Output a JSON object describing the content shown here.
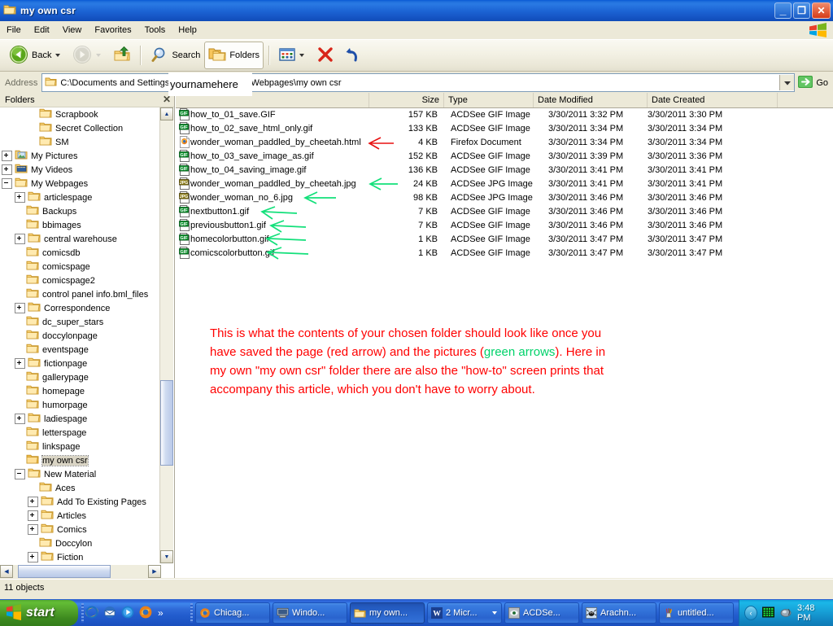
{
  "window": {
    "title": "my own csr",
    "icon": "folder-icon",
    "minimize_label": "_",
    "maximize_label": "❐",
    "close_label": "✕"
  },
  "menubar": {
    "items": [
      {
        "label": "File"
      },
      {
        "label": "Edit"
      },
      {
        "label": "View"
      },
      {
        "label": "Favorites"
      },
      {
        "label": "Tools"
      },
      {
        "label": "Help"
      }
    ],
    "brand_icon": "windows-flag-icon"
  },
  "toolbar": {
    "back_label": "Back",
    "back_icon": "back-arrow-icon",
    "forward_icon": "forward-arrow-icon",
    "up_icon": "up-folder-icon",
    "search_label": "Search",
    "search_icon": "magnifier-icon",
    "folders_label": "Folders",
    "folders_icon": "folders-icon",
    "views_icon": "views-icon",
    "delete_icon": "delete-x-icon",
    "undo_icon": "undo-arrow-icon"
  },
  "address": {
    "label": "Address",
    "icon": "folder-icon",
    "path_before": "C:\\Documents and Settings\\",
    "path_after": "\\My Documents\\My Webpages\\my own csr",
    "overlay_text": "yournamehere",
    "go_label": "Go",
    "go_icon": "go-arrow-icon",
    "dropdown_icon": "chevron-down-icon"
  },
  "folders_pane": {
    "header": "Folders",
    "close_icon": "close-icon",
    "tree": [
      {
        "label": "Scrapbook",
        "indent": 3,
        "expander": "none",
        "icon": "folder-icon",
        "selected": false
      },
      {
        "label": "Secret Collection",
        "indent": 3,
        "expander": "none",
        "icon": "folder-icon",
        "selected": false
      },
      {
        "label": "SM",
        "indent": 3,
        "expander": "none",
        "icon": "folder-icon",
        "selected": false
      },
      {
        "label": "My Pictures",
        "indent": 1,
        "expander": "plus",
        "icon": "pictures-icon",
        "selected": false
      },
      {
        "label": "My Videos",
        "indent": 1,
        "expander": "plus",
        "icon": "videos-icon",
        "selected": false
      },
      {
        "label": "My Webpages",
        "indent": 1,
        "expander": "minus",
        "icon": "folder-icon",
        "selected": false
      },
      {
        "label": "articlespage",
        "indent": 2,
        "expander": "plus",
        "icon": "folder-icon",
        "selected": false
      },
      {
        "label": "Backups",
        "indent": 2,
        "expander": "none",
        "icon": "folder-icon",
        "selected": false
      },
      {
        "label": "bbimages",
        "indent": 2,
        "expander": "none",
        "icon": "folder-icon",
        "selected": false
      },
      {
        "label": "central warehouse",
        "indent": 2,
        "expander": "plus",
        "icon": "folder-icon",
        "selected": false
      },
      {
        "label": "comicsdb",
        "indent": 2,
        "expander": "none",
        "icon": "folder-icon",
        "selected": false
      },
      {
        "label": "comicspage",
        "indent": 2,
        "expander": "none",
        "icon": "folder-icon",
        "selected": false
      },
      {
        "label": "comicspage2",
        "indent": 2,
        "expander": "none",
        "icon": "folder-icon",
        "selected": false
      },
      {
        "label": "control panel info.bml_files",
        "indent": 2,
        "expander": "none",
        "icon": "folder-icon",
        "selected": false
      },
      {
        "label": "Correspondence",
        "indent": 2,
        "expander": "plus",
        "icon": "folder-icon",
        "selected": false
      },
      {
        "label": "dc_super_stars",
        "indent": 2,
        "expander": "none",
        "icon": "folder-icon",
        "selected": false
      },
      {
        "label": "doccylonpage",
        "indent": 2,
        "expander": "none",
        "icon": "folder-icon",
        "selected": false
      },
      {
        "label": "eventspage",
        "indent": 2,
        "expander": "none",
        "icon": "folder-icon",
        "selected": false
      },
      {
        "label": "fictionpage",
        "indent": 2,
        "expander": "plus",
        "icon": "folder-icon",
        "selected": false
      },
      {
        "label": "gallerypage",
        "indent": 2,
        "expander": "none",
        "icon": "folder-icon",
        "selected": false
      },
      {
        "label": "homepage",
        "indent": 2,
        "expander": "none",
        "icon": "folder-icon",
        "selected": false
      },
      {
        "label": "humorpage",
        "indent": 2,
        "expander": "none",
        "icon": "folder-icon",
        "selected": false
      },
      {
        "label": "ladiespage",
        "indent": 2,
        "expander": "plus",
        "icon": "folder-icon",
        "selected": false
      },
      {
        "label": "letterspage",
        "indent": 2,
        "expander": "none",
        "icon": "folder-icon",
        "selected": false
      },
      {
        "label": "linkspage",
        "indent": 2,
        "expander": "none",
        "icon": "folder-icon",
        "selected": false
      },
      {
        "label": "my own csr",
        "indent": 2,
        "expander": "none",
        "icon": "folder-open-icon",
        "selected": true
      },
      {
        "label": "New Material",
        "indent": 2,
        "expander": "minus",
        "icon": "folder-icon",
        "selected": false
      },
      {
        "label": "Aces",
        "indent": 3,
        "expander": "none",
        "icon": "folder-icon",
        "selected": false
      },
      {
        "label": "Add To Existing Pages",
        "indent": 3,
        "expander": "plus",
        "icon": "folder-icon",
        "selected": false
      },
      {
        "label": "Articles",
        "indent": 3,
        "expander": "plus",
        "icon": "folder-icon",
        "selected": false
      },
      {
        "label": "Comics",
        "indent": 3,
        "expander": "plus",
        "icon": "folder-icon",
        "selected": false
      },
      {
        "label": "Doccylon",
        "indent": 3,
        "expander": "none",
        "icon": "folder-icon",
        "selected": false
      },
      {
        "label": "Fiction",
        "indent": 3,
        "expander": "plus",
        "icon": "folder-icon",
        "selected": false
      }
    ],
    "scroll_up_icon": "scroll-up-icon",
    "scroll_down_icon": "scroll-down-icon",
    "scroll_left_icon": "scroll-left-icon",
    "scroll_right_icon": "scroll-right-icon"
  },
  "file_list": {
    "columns": [
      {
        "label": "Name",
        "align": "left"
      },
      {
        "label": "Size",
        "align": "right"
      },
      {
        "label": "Type",
        "align": "left"
      },
      {
        "label": "Date Modified",
        "align": "left"
      },
      {
        "label": "Date Created",
        "align": "left"
      }
    ],
    "rows": [
      {
        "name": "how_to_01_save.GIF",
        "icon": "gif-file-icon",
        "size": "157 KB",
        "type": "ACDSee GIF Image",
        "modified": "3/30/2011 3:32 PM",
        "created": "3/30/2011 3:30 PM",
        "arrow": "none"
      },
      {
        "name": "how_to_02_save_html_only.gif",
        "icon": "gif-file-icon",
        "size": "133 KB",
        "type": "ACDSee GIF Image",
        "modified": "3/30/2011 3:34 PM",
        "created": "3/30/2011 3:34 PM",
        "arrow": "none"
      },
      {
        "name": "wonder_woman_paddled_by_cheetah.html",
        "icon": "firefox-file-icon",
        "size": "4 KB",
        "type": "Firefox Document",
        "modified": "3/30/2011 3:34 PM",
        "created": "3/30/2011 3:34 PM",
        "arrow": "red"
      },
      {
        "name": "how_to_03_save_image_as.gif",
        "icon": "gif-file-icon",
        "size": "152 KB",
        "type": "ACDSee GIF Image",
        "modified": "3/30/2011 3:39 PM",
        "created": "3/30/2011 3:36 PM",
        "arrow": "none"
      },
      {
        "name": "how_to_04_saving_image.gif",
        "icon": "gif-file-icon",
        "size": "136 KB",
        "type": "ACDSee GIF Image",
        "modified": "3/30/2011 3:41 PM",
        "created": "3/30/2011 3:41 PM",
        "arrow": "none"
      },
      {
        "name": "wonder_woman_paddled_by_cheetah.jpg",
        "icon": "jpg-file-icon",
        "size": "24 KB",
        "type": "ACDSee JPG Image",
        "modified": "3/30/2011 3:41 PM",
        "created": "3/30/2011 3:41 PM",
        "arrow": "green"
      },
      {
        "name": "wonder_woman_no_6.jpg",
        "icon": "jpg-file-icon",
        "size": "98 KB",
        "type": "ACDSee JPG Image",
        "modified": "3/30/2011 3:46 PM",
        "created": "3/30/2011 3:46 PM",
        "arrow": "green"
      },
      {
        "name": "nextbutton1.gif",
        "icon": "gif-file-icon",
        "size": "7 KB",
        "type": "ACDSee GIF Image",
        "modified": "3/30/2011 3:46 PM",
        "created": "3/30/2011 3:46 PM",
        "arrow": "green"
      },
      {
        "name": "previousbutton1.gif",
        "icon": "gif-file-icon",
        "size": "7 KB",
        "type": "ACDSee GIF Image",
        "modified": "3/30/2011 3:46 PM",
        "created": "3/30/2011 3:46 PM",
        "arrow": "green"
      },
      {
        "name": "homecolorbutton.gif",
        "icon": "gif-file-icon",
        "size": "1 KB",
        "type": "ACDSee GIF Image",
        "modified": "3/30/2011 3:47 PM",
        "created": "3/30/2011 3:47 PM",
        "arrow": "green"
      },
      {
        "name": "comicscolorbutton.gif",
        "icon": "gif-file-icon",
        "size": "1 KB",
        "type": "ACDSee GIF Image",
        "modified": "3/30/2011 3:47 PM",
        "created": "3/30/2011 3:47 PM",
        "arrow": "green"
      }
    ]
  },
  "annotation": {
    "line1": "This is what the contents of your chosen folder should look like once you",
    "line2a": "have saved the page (red arrow) and the pictures (",
    "line2green": "green arrows",
    "line2b": ").  Here in",
    "line3": "my own \"my own csr\" folder there are also the \"how-to\" screen prints that",
    "line4": "accompany this article, which you don't have to worry about.",
    "red_color": "#ff0000",
    "green_color": "#00d26a"
  },
  "statusbar": {
    "text": "11 objects"
  },
  "taskbar": {
    "start_label": "start",
    "start_icon": "windows-flag-icon",
    "quick_launch": [
      {
        "icon": "internet-explorer-icon"
      },
      {
        "icon": "outlook-express-icon"
      },
      {
        "icon": "media-icon"
      },
      {
        "icon": "firefox-icon"
      }
    ],
    "quick_launch_more": "»",
    "tasks": [
      {
        "label": "Chicag...",
        "icon": "firefox-icon",
        "active": false,
        "has_caret": false
      },
      {
        "label": "Windo...",
        "icon": "computer-icon",
        "active": false,
        "has_caret": false
      },
      {
        "label": "my own...",
        "icon": "folder-icon",
        "active": true,
        "has_caret": false
      },
      {
        "label": "2 Micr...",
        "icon": "word-icon",
        "active": false,
        "has_caret": true
      },
      {
        "label": "ACDSe...",
        "icon": "acdsee-icon",
        "active": false,
        "has_caret": false
      },
      {
        "label": "Arachn...",
        "icon": "arachnophilia-icon",
        "active": false,
        "has_caret": false
      },
      {
        "label": "untitled...",
        "icon": "paint-icon",
        "active": false,
        "has_caret": false
      }
    ],
    "tray": {
      "chevron": "‹",
      "icons": [
        "network-icon",
        "volume-icon"
      ],
      "clock": "3:48 PM"
    }
  }
}
